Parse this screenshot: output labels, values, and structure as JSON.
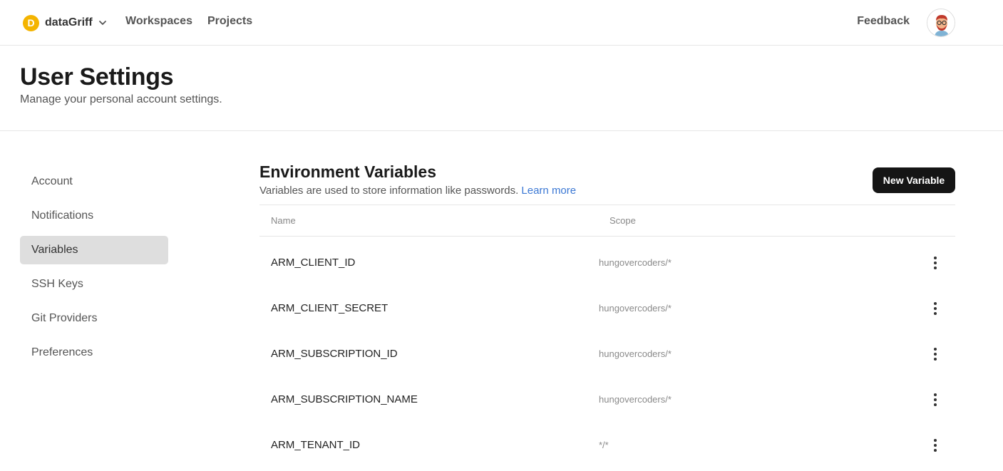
{
  "topbar": {
    "org_initial": "D",
    "org_name": "dataGriff",
    "nav": [
      "Workspaces",
      "Projects"
    ],
    "feedback": "Feedback"
  },
  "header": {
    "title": "User Settings",
    "subtitle": "Manage your personal account settings."
  },
  "sidebar": {
    "items": [
      {
        "label": "Account",
        "active": false
      },
      {
        "label": "Notifications",
        "active": false
      },
      {
        "label": "Variables",
        "active": true
      },
      {
        "label": "SSH Keys",
        "active": false
      },
      {
        "label": "Git Providers",
        "active": false
      },
      {
        "label": "Preferences",
        "active": false
      }
    ]
  },
  "main": {
    "title": "Environment Variables",
    "subtitle": "Variables are used to store information like passwords.",
    "learn_more": "Learn more",
    "new_button": "New Variable",
    "columns": [
      "Name",
      "Scope"
    ],
    "rows": [
      {
        "name": "ARM_CLIENT_ID",
        "scope": "hungovercoders/*"
      },
      {
        "name": "ARM_CLIENT_SECRET",
        "scope": "hungovercoders/*"
      },
      {
        "name": "ARM_SUBSCRIPTION_ID",
        "scope": "hungovercoders/*"
      },
      {
        "name": "ARM_SUBSCRIPTION_NAME",
        "scope": "hungovercoders/*"
      },
      {
        "name": "ARM_TENANT_ID",
        "scope": "*/*"
      }
    ]
  },
  "colors": {
    "accent_link": "#3b78d4",
    "org_badge": "#f4b400",
    "button_bg": "#151515",
    "active_item_bg": "#dedede"
  },
  "icons": {
    "org_dropdown": "chevron-down-icon",
    "row_menu": "more-vertical-icon",
    "avatar": "user-avatar"
  }
}
